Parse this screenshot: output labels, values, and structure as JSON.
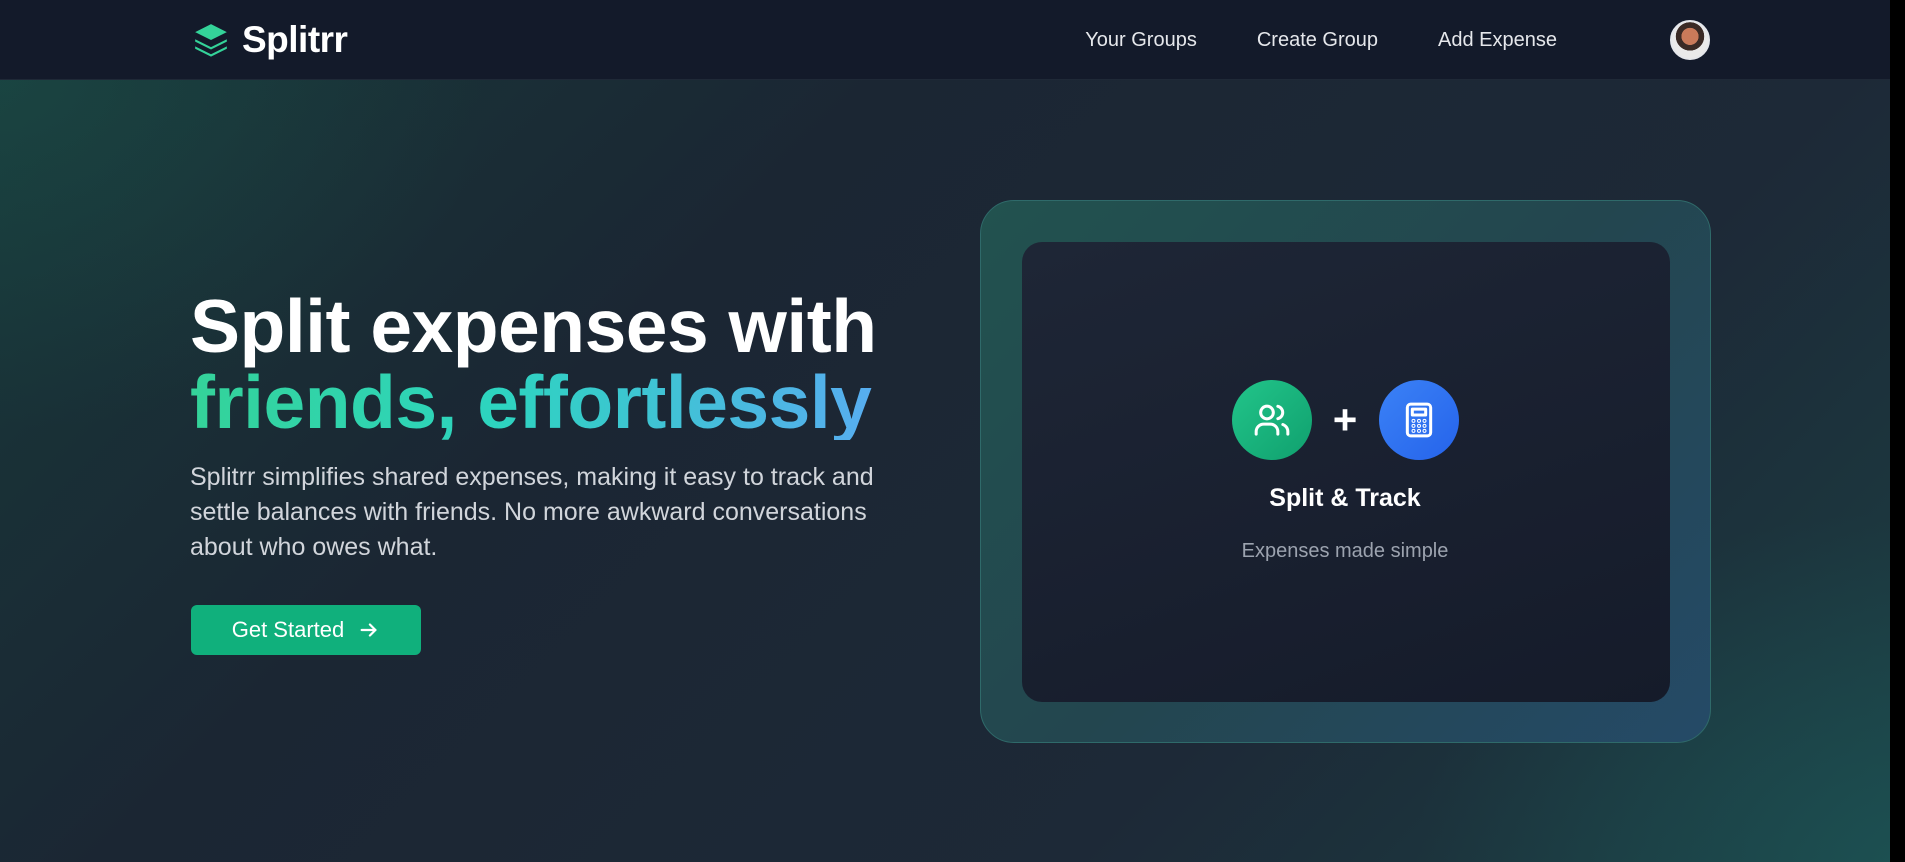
{
  "brand": {
    "name": "Splitrr",
    "icon": "layers-icon",
    "color": "#34d399"
  },
  "nav": {
    "links": [
      "Your Groups",
      "Create Group",
      "Add Expense"
    ],
    "avatar": "user-avatar"
  },
  "hero": {
    "title_line1": "Split expenses with",
    "title_line2": "friends, effortlessly",
    "description": "Splitrr simplifies shared expenses, making it easy to track and settle balances with friends. No more awkward conversations about who owes what.",
    "cta_label": "Get Started",
    "cta_icon": "arrow-right-icon",
    "cta_color": "#10b07c"
  },
  "card": {
    "icons": [
      "users-icon",
      "calculator-icon"
    ],
    "plus": "+",
    "title": "Split & Track",
    "subtitle": "Expenses made simple"
  }
}
